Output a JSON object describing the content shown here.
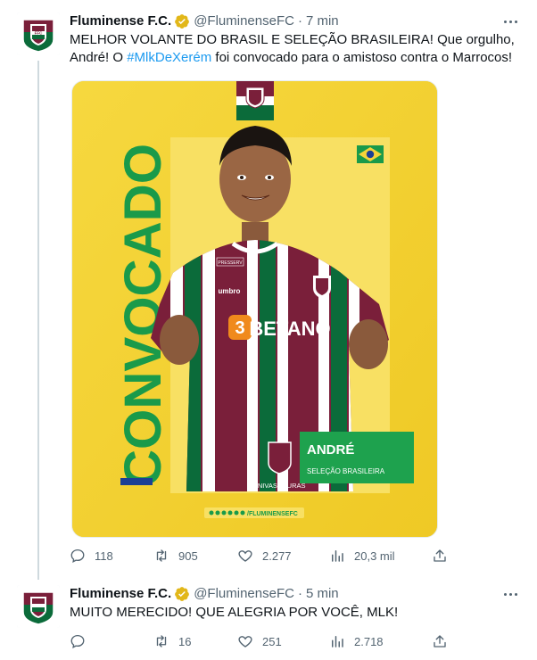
{
  "tweets": [
    {
      "display_name": "Fluminense F.C.",
      "handle": "@FluminenseFC",
      "time": "7 min",
      "text_before": "MELHOR VOLANTE DO BRASIL E SELEÇÃO BRASILEIRA! Que orgulho, André! O ",
      "hashtag": "#MlkDeXerém",
      "text_after": " foi convocado para o amistoso contra o Marrocos!",
      "replies": "118",
      "retweets": "905",
      "likes": "2.277",
      "views": "20,3 mil",
      "media": {
        "vertical_word": "CONVOCADO",
        "player_name": "ANDRÉ",
        "player_team": "SELEÇÃO BRASILEIRA",
        "sponsor": "BETANO",
        "kit_brand": "umbro",
        "sponsor_bottom": "UNIVASSOURAS",
        "sleeve_badge": "PRESSERV",
        "footer_handle": "/FLUMINENSEFC"
      }
    },
    {
      "display_name": "Fluminense F.C.",
      "handle": "@FluminenseFC",
      "time": "5 min",
      "text": "MUITO MERECIDO! QUE ALEGRIA POR VOCÊ, MLK!",
      "replies": "",
      "retweets": "16",
      "likes": "251",
      "views": "2.718"
    }
  ],
  "colors": {
    "text": "#0f1419",
    "muted": "#536471",
    "link": "#1d9bf0",
    "verified": "#e2b719",
    "club_maroon": "#7a1f3a",
    "club_green": "#0b6b3a",
    "yellow": "#f5d33a",
    "brazil_green": "#1a9a4a"
  }
}
